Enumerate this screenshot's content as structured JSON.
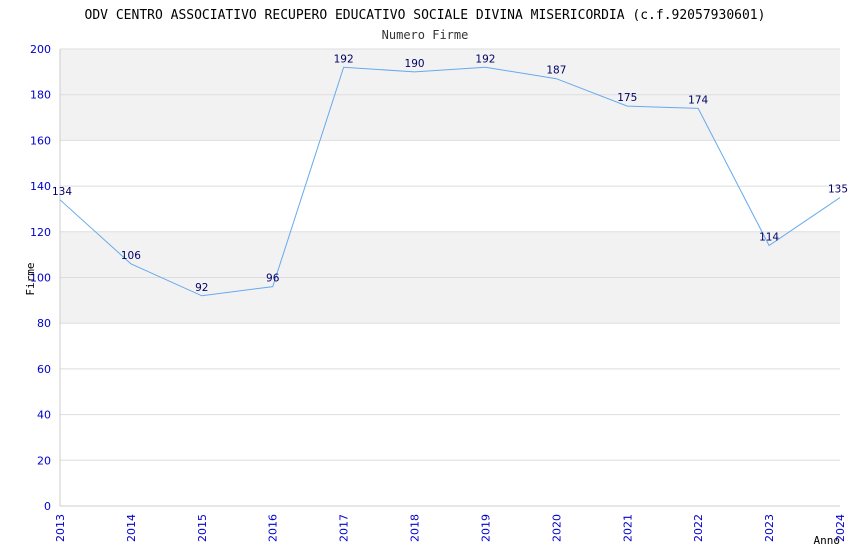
{
  "chart_data": {
    "type": "line",
    "title": "ODV CENTRO ASSOCIATIVO RECUPERO EDUCATIVO SOCIALE DIVINA MISERICORDIA (c.f.92057930601)",
    "subtitle": "Numero Firme",
    "xlabel": "Anno",
    "ylabel": "Firme",
    "x": [
      "2013",
      "2014",
      "2015",
      "2016",
      "2017",
      "2018",
      "2019",
      "2020",
      "2021",
      "2022",
      "2023",
      "2024"
    ],
    "series": [
      {
        "values": [
          134,
          106,
          92,
          96,
          192,
          190,
          192,
          187,
          175,
          174,
          114,
          135
        ]
      }
    ],
    "ylim": [
      0,
      200
    ],
    "yticks": [
      0,
      20,
      40,
      60,
      80,
      100,
      120,
      140,
      160,
      180,
      200
    ],
    "grid": true,
    "colors": {
      "line": "#66aaee",
      "band": "#f2f2f2",
      "grid": "#dddddd",
      "tick_text": "#0000cc",
      "label_text": "#000066"
    }
  }
}
